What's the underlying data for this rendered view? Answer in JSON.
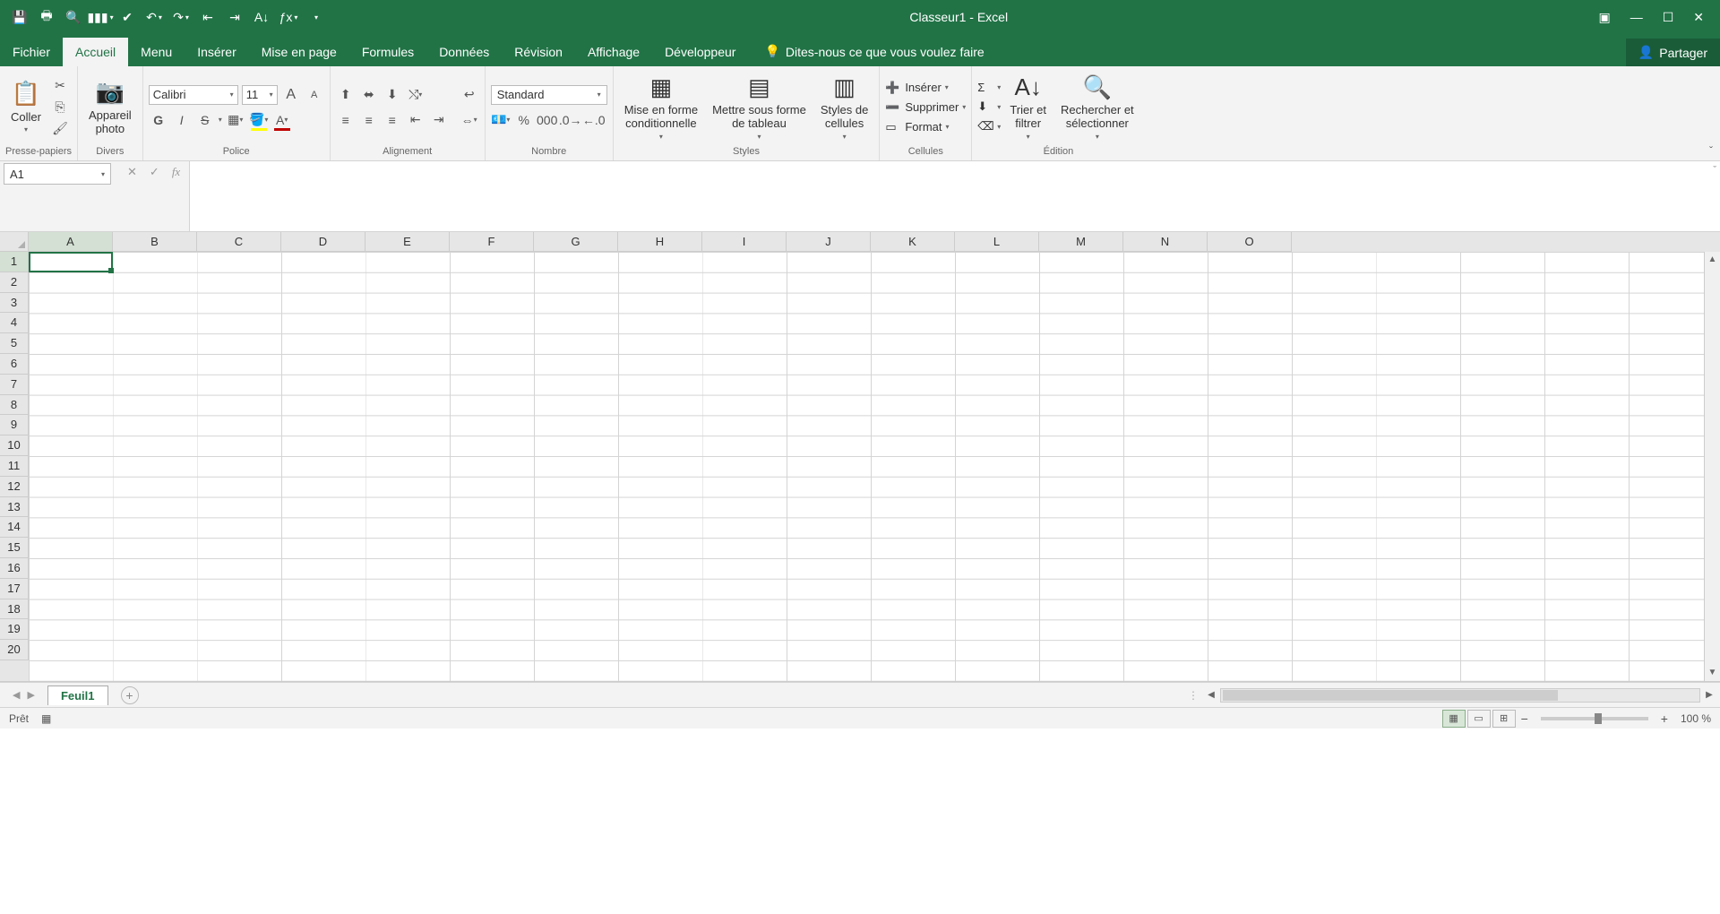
{
  "title": "Classeur1  -  Excel",
  "qat_icons": [
    "save-icon",
    "quickprint-icon",
    "printpreview-icon",
    "chart-icon",
    "spellcheck-icon",
    "undo-icon",
    "redo-icon",
    "outdent-icon",
    "indent-icon",
    "sort-az-icon",
    "function-icon",
    "customize-icon"
  ],
  "tabs": [
    "Fichier",
    "Accueil",
    "Menu",
    "Insérer",
    "Mise en page",
    "Formules",
    "Données",
    "Révision",
    "Affichage",
    "Développeur"
  ],
  "active_tab_index": 1,
  "tellme": "Dites-nous ce que vous voulez faire",
  "share": "Partager",
  "ribbon": {
    "clipboard": {
      "paste": "Coller",
      "label": "Presse-papiers"
    },
    "camera": {
      "btn": "Appareil\nphoto",
      "label": "Divers"
    },
    "font": {
      "name": "Calibri",
      "size": "11",
      "label": "Police",
      "bold": "G",
      "italic": "I",
      "underline": "S"
    },
    "align": {
      "label": "Alignement"
    },
    "number": {
      "format": "Standard",
      "label": "Nombre"
    },
    "styles": {
      "cond": "Mise en forme\nconditionnelle",
      "table": "Mettre sous forme\nde tableau",
      "cell": "Styles de\ncellules",
      "label": "Styles"
    },
    "cells": {
      "insert": "Insérer",
      "delete": "Supprimer",
      "format": "Format",
      "label": "Cellules"
    },
    "editing": {
      "sort": "Trier et\nfiltrer",
      "find": "Rechercher et\nsélectionner",
      "label": "Édition"
    }
  },
  "namebox": "A1",
  "columns": [
    "A",
    "B",
    "C",
    "D",
    "E",
    "F",
    "G",
    "H",
    "I",
    "J",
    "K",
    "L",
    "M",
    "N",
    "O"
  ],
  "rows": 20,
  "sheet_tab": "Feuil1",
  "status": "Prêt",
  "zoom": "100 %"
}
